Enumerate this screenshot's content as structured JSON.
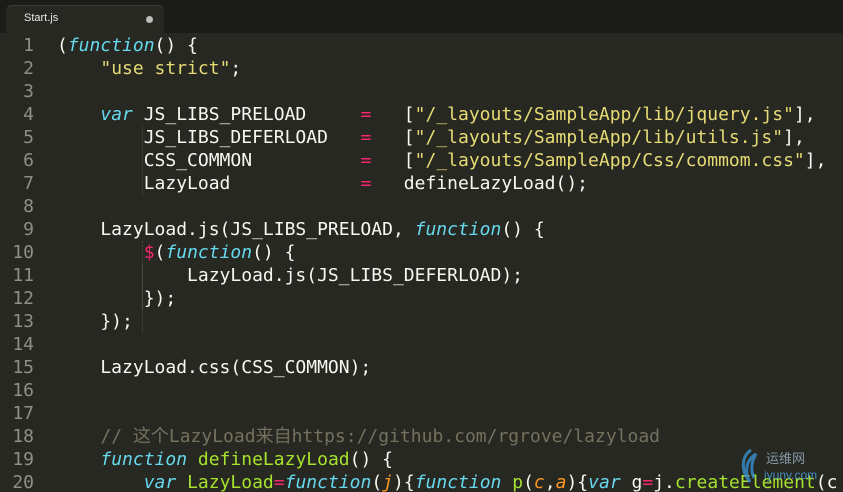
{
  "tab": {
    "title": "Start.js",
    "modified": true
  },
  "watermark": {
    "logo_text": "运维网",
    "url": "iyunv.com"
  },
  "colors": {
    "background": "#272822",
    "string": "#e6db74",
    "keyword": "#66d9ef",
    "operator": "#f92672",
    "function_name": "#a6e22e",
    "comment": "#75715e",
    "parameter": "#fd971f"
  },
  "lines": [
    {
      "n": "1",
      "tokens": [
        [
          "p",
          "("
        ],
        [
          "kw",
          "function"
        ],
        [
          "p",
          "() {"
        ]
      ]
    },
    {
      "n": "2",
      "tokens": [
        [
          "p",
          "    "
        ],
        [
          "str",
          "\"use strict\""
        ],
        [
          "p",
          ";"
        ]
      ]
    },
    {
      "n": "3",
      "tokens": []
    },
    {
      "n": "4",
      "tokens": [
        [
          "p",
          "    "
        ],
        [
          "kw",
          "var"
        ],
        [
          "p",
          " JS_LIBS_PRELOAD     "
        ],
        [
          "op",
          "="
        ],
        [
          "p",
          "   ["
        ],
        [
          "str",
          "\"/_layouts/SampleApp/lib/jquery.js\""
        ],
        [
          "p",
          "],"
        ]
      ]
    },
    {
      "n": "5",
      "tokens": [
        [
          "p",
          "        JS_LIBS_DEFERLOAD   "
        ],
        [
          "op",
          "="
        ],
        [
          "p",
          "   ["
        ],
        [
          "str",
          "\"/_layouts/SampleApp/lib/utils.js\""
        ],
        [
          "p",
          "],"
        ]
      ]
    },
    {
      "n": "6",
      "tokens": [
        [
          "p",
          "        CSS_COMMON          "
        ],
        [
          "op",
          "="
        ],
        [
          "p",
          "   ["
        ],
        [
          "str",
          "\"/_layouts/SampleApp/Css/commom.css\""
        ],
        [
          "p",
          "],"
        ]
      ]
    },
    {
      "n": "7",
      "tokens": [
        [
          "p",
          "        LazyLoad            "
        ],
        [
          "op",
          "="
        ],
        [
          "p",
          "   defineLazyLoad();"
        ]
      ]
    },
    {
      "n": "8",
      "tokens": []
    },
    {
      "n": "9",
      "tokens": [
        [
          "p",
          "    LazyLoad.js(JS_LIBS_PRELOAD, "
        ],
        [
          "kw",
          "function"
        ],
        [
          "p",
          "() {"
        ]
      ]
    },
    {
      "n": "10",
      "tokens": [
        [
          "p",
          "        "
        ],
        [
          "op",
          "$"
        ],
        [
          "p",
          "("
        ],
        [
          "kw",
          "function"
        ],
        [
          "p",
          "() {"
        ]
      ]
    },
    {
      "n": "11",
      "tokens": [
        [
          "p",
          "            LazyLoad.js(JS_LIBS_DEFERLOAD);"
        ]
      ]
    },
    {
      "n": "12",
      "tokens": [
        [
          "p",
          "        });"
        ]
      ]
    },
    {
      "n": "13",
      "tokens": [
        [
          "p",
          "    });"
        ]
      ]
    },
    {
      "n": "14",
      "tokens": []
    },
    {
      "n": "15",
      "tokens": [
        [
          "p",
          "    LazyLoad.css(CSS_COMMON);"
        ]
      ]
    },
    {
      "n": "16",
      "tokens": []
    },
    {
      "n": "17",
      "tokens": []
    },
    {
      "n": "18",
      "tokens": [
        [
          "p",
          "    "
        ],
        [
          "cm",
          "// 这个LazyLoad来自https://github.com/rgrove/lazyload"
        ]
      ]
    },
    {
      "n": "19",
      "tokens": [
        [
          "p",
          "    "
        ],
        [
          "kw",
          "function"
        ],
        [
          "p",
          " "
        ],
        [
          "fn",
          "defineLazyLoad"
        ],
        [
          "p",
          "() {"
        ]
      ]
    },
    {
      "n": "20",
      "tokens": [
        [
          "p",
          "        "
        ],
        [
          "kw",
          "var"
        ],
        [
          "p",
          " "
        ],
        [
          "fn",
          "LazyLoad"
        ],
        [
          "op",
          "="
        ],
        [
          "kw",
          "function"
        ],
        [
          "p",
          "("
        ],
        [
          "arg",
          "j"
        ],
        [
          "p",
          "){"
        ],
        [
          "kw",
          "function"
        ],
        [
          "p",
          " "
        ],
        [
          "fn",
          "p"
        ],
        [
          "p",
          "("
        ],
        [
          "arg",
          "c"
        ],
        [
          "p",
          ","
        ],
        [
          "arg",
          "a"
        ],
        [
          "p",
          "){"
        ],
        [
          "kw",
          "var"
        ],
        [
          "p",
          " g"
        ],
        [
          "op",
          "="
        ],
        [
          "p",
          "j."
        ],
        [
          "fn",
          "createElement"
        ],
        [
          "p",
          "(c"
        ]
      ]
    }
  ]
}
